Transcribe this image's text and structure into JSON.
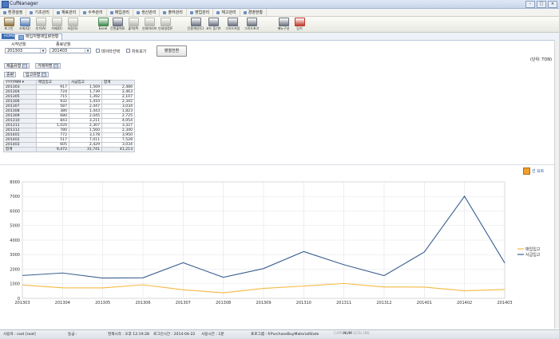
{
  "window": {
    "title": "CufNanager"
  },
  "menu": [
    "환경설정",
    "기초관리",
    "재료관리",
    "수주관리",
    "매입관리",
    "생산관리",
    "출하관리",
    "영업관리",
    "재고관리",
    "경영현황"
  ],
  "toolbar": {
    "buttons": [
      {
        "label": "포그인",
        "icon": "key-icon",
        "color": "#8a6f3a"
      },
      {
        "label": "조회(Q)",
        "icon": "search-icon",
        "color": "#5b7fb3"
      },
      {
        "label": "추가(A)",
        "icon": "add-icon",
        "color": "#b8b8b0"
      },
      {
        "label": "삭제(D)",
        "icon": "delete-icon",
        "color": "#b8b8b0"
      },
      {
        "label": "저장(S)",
        "icon": "save-icon",
        "color": "#b8b8b0"
      },
      {
        "label": "Excel",
        "icon": "excel-icon",
        "color": "#3f8a4a"
      },
      {
        "label": "간편출력(E)",
        "icon": "print-icon",
        "color": "#6b7280"
      },
      {
        "label": "출력(P)",
        "icon": "printer-icon",
        "color": "#b8b8b0"
      },
      {
        "label": "인쇄미리보기",
        "icon": "preview-icon",
        "color": "#b8b8b0"
      },
      {
        "label": "인쇄설정(R)",
        "icon": "print-settings-icon",
        "color": "#b8b8b0"
      },
      {
        "label": "단중계산(C)",
        "icon": "calculator-icon",
        "color": "#6b7280"
      },
      {
        "label": "코드 동기화",
        "icon": "sync-icon",
        "color": "#6b7280"
      },
      {
        "label": "그리드저장",
        "icon": "grid-save-icon",
        "color": "#6b7280"
      },
      {
        "label": "그리드초기화",
        "icon": "grid-reset-icon",
        "color": "#6b7280"
      },
      {
        "label": "메뉴구성",
        "icon": "menu-config-icon",
        "color": "#6b7280"
      },
      {
        "label": "닫기",
        "icon": "close-icon",
        "color": "#c0392b"
      }
    ]
  },
  "tabs": {
    "home": "HOME",
    "active": "매입처별매입량현황"
  },
  "filters": {
    "start_label": "시작년월",
    "start_value": "201303",
    "end_label": "종료년월",
    "end_value": "201403",
    "data_select_label": "데이타선택",
    "chart_view_label": "차트보기",
    "query_button": "병렬전환",
    "unit": "(단위: TON)"
  },
  "pivot": {
    "field1": "제품유형",
    "field2": "거래처명",
    "field3": "중량",
    "field4": "입고유형",
    "row_field": "YYYYMM",
    "columns": [
      "매입입고",
      "사급입고",
      "합계"
    ],
    "rows": [
      {
        "ym": "201303",
        "v": [
          "917",
          "1,569",
          "2,486"
        ]
      },
      {
        "ym": "201304",
        "v": [
          "724",
          "1,739",
          "2,463"
        ]
      },
      {
        "ym": "201305",
        "v": [
          "715",
          "1,392",
          "2,107"
        ]
      },
      {
        "ym": "201306",
        "v": [
          "932",
          "1,410",
          "2,342"
        ]
      },
      {
        "ym": "201307",
        "v": [
          "587",
          "2,447",
          "3,034"
        ]
      },
      {
        "ym": "201308",
        "v": [
          "380",
          "1,443",
          "1,823"
        ]
      },
      {
        "ym": "201309",
        "v": [
          "680",
          "2,045",
          "2,725"
        ]
      },
      {
        "ym": "201310",
        "v": [
          "843",
          "3,211",
          "4,054"
        ]
      },
      {
        "ym": "201311",
        "v": [
          "1,020",
          "2,307",
          "3,327"
        ]
      },
      {
        "ym": "201312",
        "v": [
          "780",
          "1,560",
          "2,340"
        ]
      },
      {
        "ym": "201401",
        "v": [
          "772",
          "3,178",
          "3,950"
        ]
      },
      {
        "ym": "201402",
        "v": [
          "517",
          "7,011",
          "7,528"
        ]
      },
      {
        "ym": "201403",
        "v": [
          "605",
          "2,429",
          "3,034"
        ]
      }
    ],
    "total_label": "합계",
    "totals": [
      "9,472",
      "31,741",
      "41,213"
    ]
  },
  "chart_options_label": "선 요트",
  "chart_data": {
    "type": "line",
    "categories": [
      "201303",
      "201304",
      "201305",
      "201306",
      "201307",
      "201308",
      "201309",
      "201310",
      "201311",
      "201312",
      "201401",
      "201402",
      "201403"
    ],
    "series": [
      {
        "name": "매입입고",
        "color": "#f5b942",
        "values": [
          917,
          724,
          715,
          932,
          587,
          380,
          680,
          843,
          1020,
          780,
          772,
          517,
          605
        ]
      },
      {
        "name": "사급입고",
        "color": "#3b5f8f",
        "values": [
          1569,
          1739,
          1392,
          1410,
          2447,
          1443,
          2045,
          3211,
          2307,
          1560,
          3178,
          7011,
          2429
        ]
      }
    ],
    "yticks": [
      "0",
      "1000",
      "2000",
      "3000",
      "4000",
      "5000",
      "6000",
      "7000",
      "8000"
    ],
    "ylim": [
      0,
      8000
    ],
    "grid": true,
    "legend": "right"
  },
  "status": {
    "user": "사용자 : root [root]",
    "grade": "등급 :",
    "time": "현재시각 : 오후 12:19:28",
    "login_date": "로그인시간 : 2014-04-22",
    "usage": "사용시간 : 1분",
    "program": "프로그램 : frPurchaseBuyMaterialState",
    "caps": "CAPS",
    "num": "NUM",
    "scrl": "SCRL",
    "ins": "INS"
  }
}
